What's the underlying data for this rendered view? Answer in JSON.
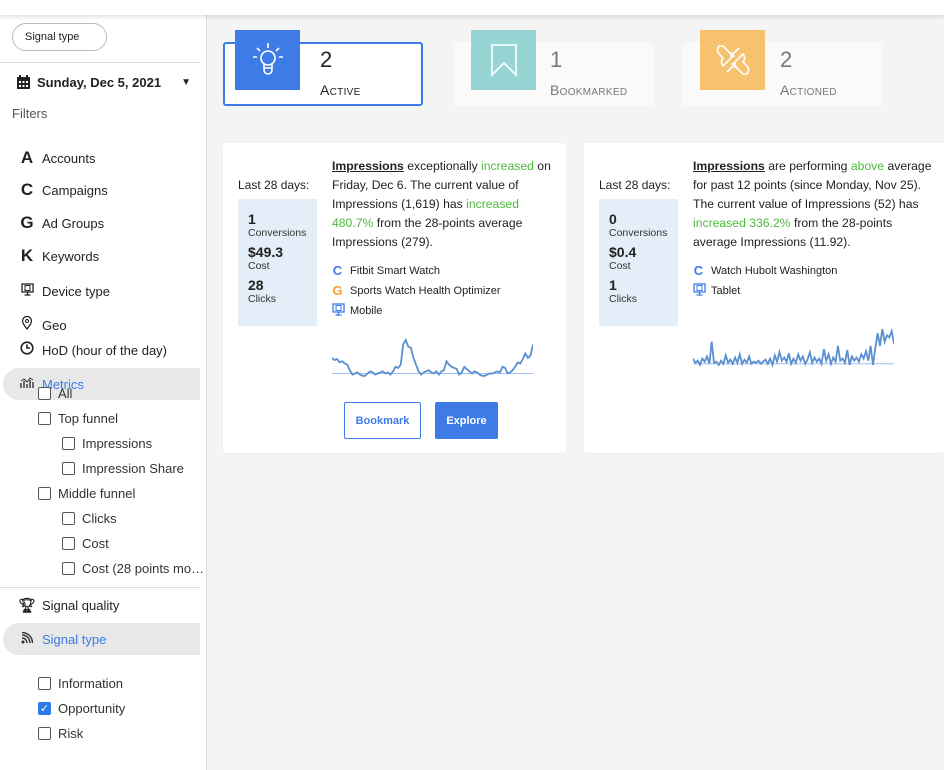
{
  "sidebar": {
    "chip": "Signal type",
    "date": "Sunday, Dec 5, 2021",
    "filters_label": "Filters",
    "items": [
      {
        "icon": "A",
        "label": "Accounts"
      },
      {
        "icon": "C",
        "label": "Campaigns"
      },
      {
        "icon": "G",
        "label": "Ad Groups"
      },
      {
        "icon": "K",
        "label": "Keywords"
      },
      {
        "icon": "device-icon",
        "label": "Device type"
      },
      {
        "icon": "location-pin-icon",
        "label": "Geo"
      },
      {
        "icon": "clock-icon",
        "label": "HoD (hour of the day)"
      },
      {
        "icon": "chart-icon",
        "label": "Metrics"
      }
    ],
    "metrics": [
      {
        "label": "All",
        "checked": false,
        "level": 1
      },
      {
        "label": "Top funnel",
        "checked": false,
        "level": 1
      },
      {
        "label": "Impressions",
        "checked": false,
        "level": 2
      },
      {
        "label": "Impression Share",
        "checked": false,
        "level": 2
      },
      {
        "label": "Middle funnel",
        "checked": false,
        "level": 1
      },
      {
        "label": "Clicks",
        "checked": false,
        "level": 2
      },
      {
        "label": "Cost",
        "checked": false,
        "level": 2
      },
      {
        "label": "Cost (28 points mo…",
        "checked": false,
        "level": 2
      }
    ],
    "signal_quality": "Signal quality",
    "signal_type": "Signal type",
    "types": [
      {
        "label": "Information",
        "checked": false
      },
      {
        "label": "Opportunity",
        "checked": true
      },
      {
        "label": "Risk",
        "checked": false
      }
    ]
  },
  "status": [
    {
      "count": "2",
      "label": "Active",
      "color": "#3d7be6",
      "icon": "lightbulb-icon"
    },
    {
      "count": "1",
      "label": "Bookmarked",
      "color": "#96d5d3",
      "icon": "bookmark-icon"
    },
    {
      "count": "2",
      "label": "Actioned",
      "color": "#f6c26f",
      "icon": "actioned-icon"
    }
  ],
  "cards": [
    {
      "last": "Last 28 days:",
      "conversions": "1",
      "conversions_label": "Conversions",
      "cost": "$49.3",
      "cost_label": "Cost",
      "clicks": "28",
      "clicks_label": "Clicks",
      "d": [
        "Impressions",
        " exceptionally ",
        "increased",
        " on Friday, Dec 6. The current value of Impressions (1,619) has ",
        "increased 480.7%",
        " from the 28-points average Impressions (279)."
      ],
      "meta": [
        {
          "icon": "C",
          "color": "#3d7be6",
          "label": "Fitbit Smart Watch"
        },
        {
          "icon": "G",
          "color": "#f2a22b",
          "label": "Sports Watch Health Optimizer"
        },
        {
          "icon": "device-icon",
          "color": "#3d7be6",
          "label": "Mobile"
        }
      ],
      "spark": [
        18,
        16,
        17,
        14,
        15,
        13,
        12,
        7,
        3,
        4,
        5,
        3,
        2,
        2,
        4,
        6,
        5,
        3,
        4,
        5,
        6,
        4,
        5,
        3,
        6,
        10,
        9,
        12,
        30,
        34,
        28,
        27,
        18,
        12,
        6,
        3,
        5,
        6,
        7,
        5,
        4,
        6,
        3,
        6,
        7,
        15,
        12,
        10,
        9,
        8,
        3,
        5,
        10,
        8,
        6,
        4,
        6,
        5,
        3,
        2,
        2,
        3,
        4,
        4,
        5,
        6,
        5,
        10,
        9,
        4,
        5,
        7,
        10,
        14,
        13,
        17,
        22,
        18,
        20,
        30
      ],
      "baseline": 4,
      "bookmark": "Bookmark",
      "explore": "Explore"
    },
    {
      "last": "Last 28 days:",
      "conversions": "0",
      "conversions_label": "Conversions",
      "cost": "$0.4",
      "cost_label": "Cost",
      "clicks": "1",
      "clicks_label": "Clicks",
      "d": [
        "Impressions",
        " are performing ",
        "above",
        " average for past 12 points (since Monday, Nov 25). The current value of Impressions (52) has ",
        "increased 336.2%",
        " from the 28-points average Impressions (11.92)."
      ],
      "meta": [
        {
          "icon": "C",
          "color": "#3d7be6",
          "label": "Watch Hubolt Washington"
        },
        {
          "icon": "device-icon",
          "color": "#3d7be6",
          "label": "Tablet"
        }
      ],
      "spark": [
        8,
        4,
        6,
        2,
        8,
        5,
        10,
        3,
        24,
        4,
        5,
        2,
        6,
        3,
        11,
        4,
        7,
        3,
        9,
        4,
        12,
        3,
        7,
        4,
        10,
        3,
        5,
        4,
        6,
        3,
        5,
        7,
        3,
        8,
        2,
        11,
        5,
        14,
        6,
        9,
        5,
        13,
        3,
        8,
        4,
        12,
        6,
        10,
        3,
        7,
        14,
        4,
        9,
        5,
        8,
        3,
        17,
        6,
        12,
        3,
        9,
        5,
        20,
        6,
        8,
        4,
        16,
        2,
        10,
        6,
        9,
        5,
        12,
        8,
        15,
        6,
        20,
        2,
        18,
        32,
        20,
        36,
        24,
        30,
        28,
        34,
        22
      ],
      "baseline": 3
    }
  ]
}
